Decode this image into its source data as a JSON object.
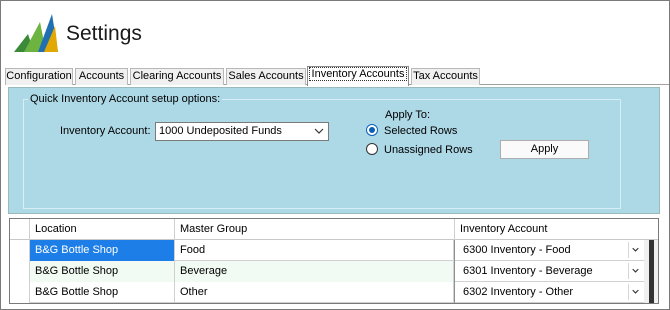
{
  "header": {
    "title": "Settings",
    "logo_icon": "dynamics-logo-icon"
  },
  "tabs": [
    {
      "label": "Configuration",
      "active": false
    },
    {
      "label": "Accounts",
      "active": false
    },
    {
      "label": "Clearing Accounts",
      "active": false
    },
    {
      "label": "Sales Accounts",
      "active": false
    },
    {
      "label": "Inventory Accounts",
      "active": true
    },
    {
      "label": "Tax Accounts",
      "active": false
    }
  ],
  "setup": {
    "group_title": "Quick Inventory Account setup options:",
    "inventory_account_label": "Inventory Account:",
    "inventory_account_value": "1000 Undeposited Funds",
    "apply_to_label": "Apply To:",
    "option_selected_rows": "Selected Rows",
    "option_unassigned_rows": "Unassigned Rows",
    "selected_option": "Selected Rows",
    "apply_button": "Apply"
  },
  "grid": {
    "columns": [
      "Location",
      "Master Group",
      "Inventory Account"
    ],
    "rows": [
      {
        "location": "B&G Bottle Shop",
        "master_group": "Food",
        "inventory_account": "6300 Inventory - Food"
      },
      {
        "location": "B&G Bottle Shop",
        "master_group": "Beverage",
        "inventory_account": "6301 Inventory - Beverage"
      },
      {
        "location": "B&G Bottle Shop",
        "master_group": "Other",
        "inventory_account": "6302 Inventory - Other"
      }
    ]
  },
  "colors": {
    "panel": "#add8e6",
    "selection": "#1e7ee8",
    "radio_accent": "#0a5fb8"
  }
}
